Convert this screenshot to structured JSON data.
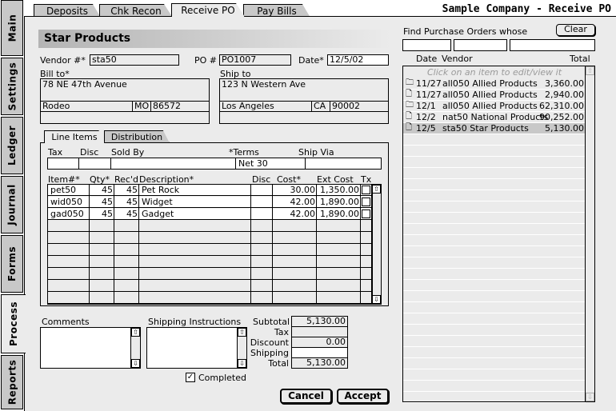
{
  "side_tabs": [
    "Main",
    "Settings",
    "Ledger",
    "Journal",
    "Forms",
    "Process",
    "Reports"
  ],
  "top_tabs": [
    "Deposits",
    "Chk Recon",
    "Receive PO",
    "Pay Bills"
  ],
  "company_title": "Sample Company - Receive PO",
  "vendor_name": "Star Products",
  "labels": {
    "vendor": "Vendor #*",
    "po": "PO #",
    "date": "Date*",
    "bill_to": "Bill to*",
    "ship_to": "Ship to"
  },
  "vendor_num": "sta50",
  "po_num": "PO1007",
  "date": "12/5/02",
  "bill_to": {
    "street": "78 NE 47th Avenue",
    "city": "Rodeo",
    "state": "MO",
    "zip": "86572"
  },
  "ship_to": {
    "street": "123 N Western Ave",
    "city": "Los Angeles",
    "state": "CA",
    "zip": "90002"
  },
  "inner_tabs": [
    "Line Items",
    "Distribution"
  ],
  "terms_headers": {
    "tax": "Tax",
    "disc": "Disc",
    "sold_by": "Sold By",
    "terms": "*Terms",
    "ship_via": "Ship Via"
  },
  "terms_value": "Net 30",
  "item_headers": {
    "item": "Item#*",
    "qty": "Qty*",
    "recd": "Rec'd",
    "desc": "Description*",
    "disc": "Disc",
    "cost": "Cost*",
    "ext": "Ext Cost",
    "tx": "Tx"
  },
  "items": [
    {
      "item": "pet50",
      "qty": "45",
      "recd": "45",
      "desc": "Pet Rock",
      "cost": "30.00",
      "ext": "1,350.00"
    },
    {
      "item": "wid050",
      "qty": "45",
      "recd": "45",
      "desc": "Widget",
      "cost": "42.00",
      "ext": "1,890.00"
    },
    {
      "item": "gad050",
      "qty": "45",
      "recd": "45",
      "desc": "Gadget",
      "cost": "42.00",
      "ext": "1,890.00"
    }
  ],
  "comments_label": "Comments",
  "shipping_label": "Shipping Instructions",
  "totals": {
    "subtotal_label": "Subtotal",
    "subtotal": "5,130.00",
    "tax_label": "Tax",
    "tax": "",
    "discount_label": "Discount",
    "discount": "0.00",
    "shipping_label": "Shipping",
    "shipping": "",
    "total_label": "Total",
    "total": "5,130.00"
  },
  "completed_label": "Completed",
  "cancel": "Cancel",
  "accept": "Accept",
  "find_label": "Find Purchase Orders whose",
  "clear": "Clear",
  "list_headers": {
    "date": "Date",
    "vendor": "Vendor",
    "total": "Total"
  },
  "list_hint": "Click on an item to edit/view it",
  "orders": [
    {
      "icon": "folder-icon",
      "date": "11/27",
      "vendor": "all050 Allied Products",
      "total": "3,360.00"
    },
    {
      "icon": "document-icon",
      "date": "11/27",
      "vendor": "all050 Allied Products",
      "total": "2,940.00"
    },
    {
      "icon": "folder-icon",
      "date": "12/1",
      "vendor": "all050 Allied Products",
      "total": "62,310.00"
    },
    {
      "icon": "document-icon",
      "date": "12/2",
      "vendor": "nat50 National Products",
      "total": "90,252.00"
    },
    {
      "icon": "document-icon",
      "date": "12/5",
      "vendor": "sta50 Star Products",
      "total": "5,130.00"
    }
  ]
}
